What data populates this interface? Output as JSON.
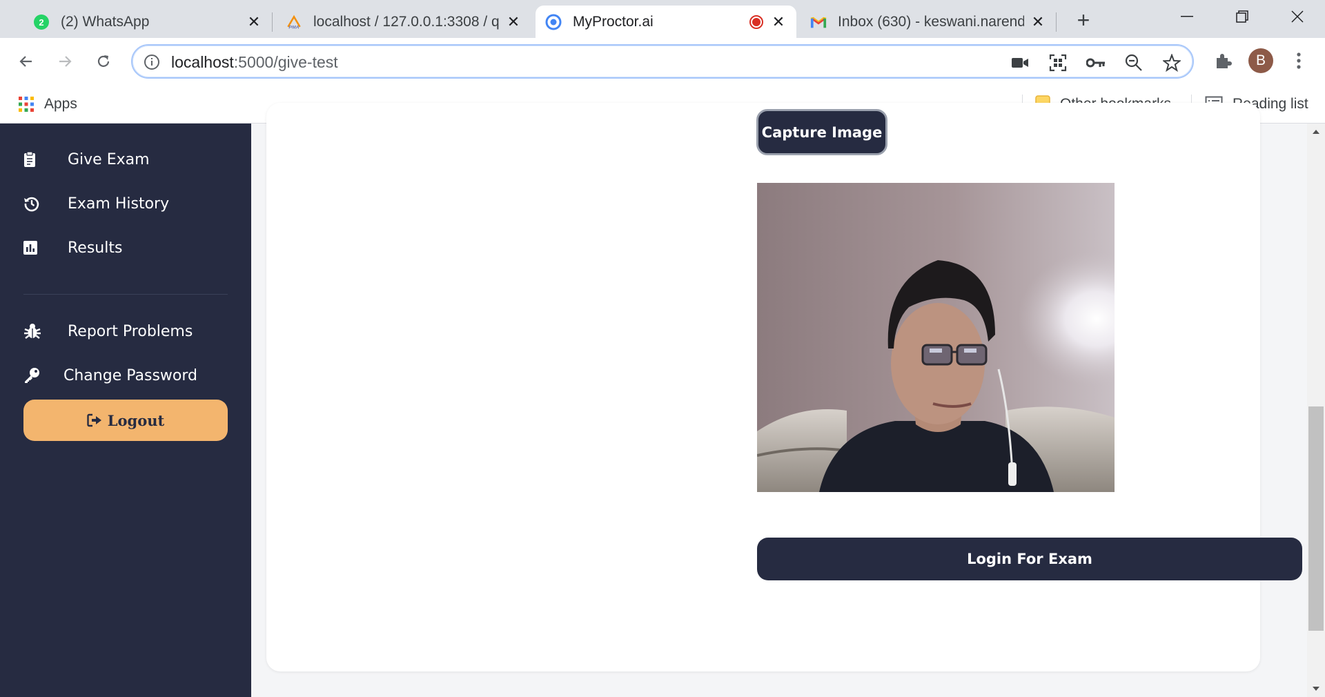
{
  "browser": {
    "tabs": [
      {
        "title": "(2) WhatsApp",
        "badge": "2",
        "icon": "whatsapp-icon"
      },
      {
        "title": "localhost / 127.0.0.1:3308 / q",
        "icon": "phpmyadmin-icon",
        "icon_text": "PMA"
      },
      {
        "title": "MyProctor.ai",
        "icon": "chrome-icon",
        "recording": true
      },
      {
        "title": "Inbox (630) - keswani.narend",
        "icon": "gmail-icon"
      }
    ],
    "address": {
      "host": "localhost",
      "path": ":5000/give-test"
    },
    "profile_initial": "B",
    "bookmarks": {
      "apps": "Apps",
      "other": "Other bookmarks",
      "reading": "Reading list"
    }
  },
  "sidebar": {
    "items": [
      {
        "label": "Give Exam",
        "icon": "clipboard-icon"
      },
      {
        "label": "Exam History",
        "icon": "history-icon"
      },
      {
        "label": "Results",
        "icon": "chart-icon"
      },
      {
        "label": "Report Problems",
        "icon": "bug-icon"
      },
      {
        "label": "Change Password",
        "icon": "key-icon"
      }
    ],
    "logout_label": "Logout"
  },
  "main": {
    "capture_label": "Capture Image",
    "login_label": "Login For Exam"
  },
  "colors": {
    "sidebar": "#262b41",
    "logout": "#f3b56e",
    "button": "#262b41"
  }
}
